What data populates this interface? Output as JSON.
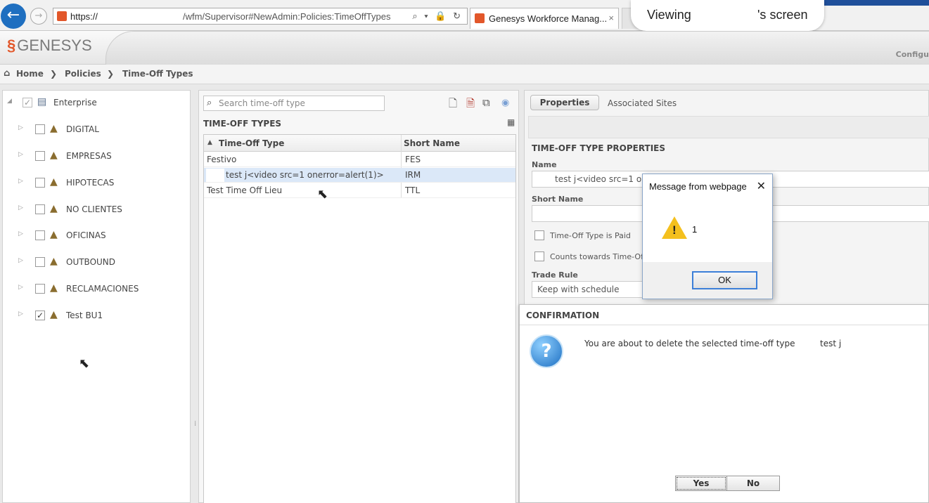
{
  "browser": {
    "url_protocol": "https://",
    "url_path": "/wfm/Supervisor#NewAdmin:Policies:TimeOffTypes",
    "tab_title": "Genesys Workforce Manag...",
    "tab_close": "×",
    "back_glyph": "←",
    "forward_glyph": "→",
    "addr_icons": "⌕ ▾ 🔒 ↻",
    "viewing_prefix": "Viewing",
    "viewing_suffix": "'s screen"
  },
  "app": {
    "logo_mark": "§",
    "logo_text": "GENESYS",
    "header_right": "Configu"
  },
  "breadcrumb": {
    "items": [
      "Home",
      "Policies",
      "Time-Off Types"
    ],
    "separator": "❯"
  },
  "tree": {
    "root": {
      "label": "Enterprise",
      "checked": "✓",
      "expander": "◢"
    },
    "items": [
      {
        "label": "DIGITAL",
        "check": ""
      },
      {
        "label": "EMPRESAS",
        "check": ""
      },
      {
        "label": "HIPOTECAS",
        "check": ""
      },
      {
        "label": "NO CLIENTES",
        "check": ""
      },
      {
        "label": "OFICINAS",
        "check": ""
      },
      {
        "label": "OUTBOUND",
        "check": ""
      },
      {
        "label": "RECLAMACIONES",
        "check": ""
      },
      {
        "label": "Test BU1",
        "check": "✓"
      }
    ],
    "expander": "▷"
  },
  "middle": {
    "search_placeholder": "Search time-off type",
    "section_title": "TIME-OFF TYPES",
    "columns": [
      "Time-Off Type",
      "Short Name"
    ],
    "rows": [
      {
        "type": "Festivo",
        "short": "FES"
      },
      {
        "type": "test j<video src=1 onerror=alert(1)>",
        "short": "IRM"
      },
      {
        "type": "Test Time Off Lieu",
        "short": "TTL"
      }
    ]
  },
  "right": {
    "tabs": [
      "Properties",
      "Associated Sites"
    ],
    "section_title": "TIME-OFF TYPE PROPERTIES",
    "name_label": "Name",
    "name_value": "test j<video src=1 onerror=alert(1)>",
    "short_name_label": "Short Name",
    "short_name_value": "",
    "paid_label": "Time-Off Type is Paid",
    "counts_label": "Counts towards Time-Off Limits",
    "trade_rule_label": "Trade Rule",
    "trade_rule_value": "Keep with schedule"
  },
  "message_box": {
    "title": "Message from webpage",
    "close": "✕",
    "message": "1",
    "ok": "OK"
  },
  "confirmation": {
    "title": "CONFIRMATION",
    "text": "You are about to delete the selected time-off type",
    "name": "test j",
    "yes": "Yes",
    "no": "No"
  },
  "colors": {
    "accent_blue": "#1f6fc0",
    "brand_orange": "#e2572a",
    "warning_yellow": "#f4c01e",
    "selection": "#dbe8f8"
  }
}
